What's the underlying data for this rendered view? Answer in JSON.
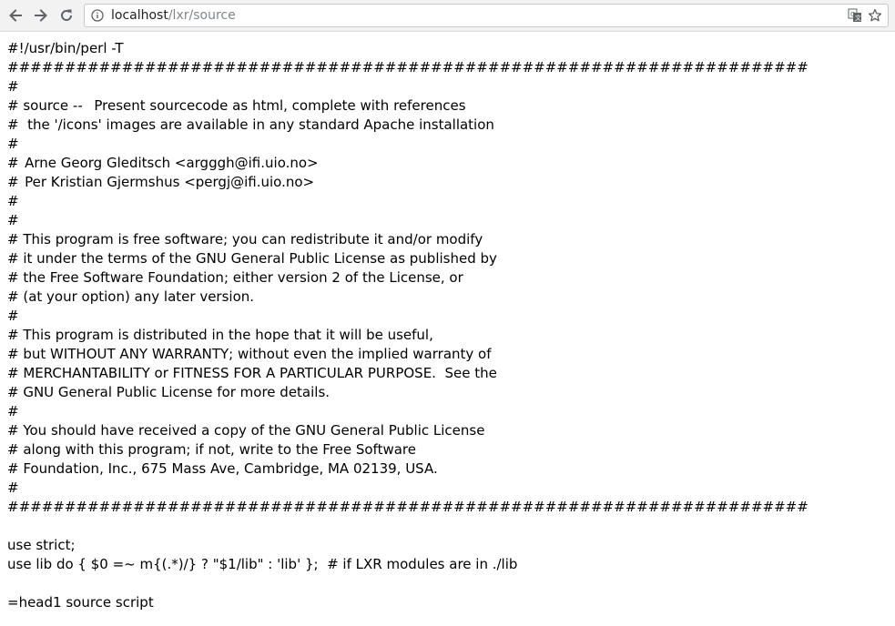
{
  "browser": {
    "url_host": "localhost",
    "url_path": "/lxr/source"
  },
  "document": {
    "lines": [
      "#!/usr/bin/perl -T",
      "######################################################################",
      "#",
      "# source --\tPresent sourcecode as html, complete with references",
      "#  the '/icons' images are available in any standard Apache installation",
      "#",
      "#\tArne Georg Gleditsch <argggh@ifi.uio.no>",
      "#\tPer Kristian Gjermshus <pergj@ifi.uio.no>",
      "#",
      "#",
      "# This program is free software; you can redistribute it and/or modify",
      "# it under the terms of the GNU General Public License as published by",
      "# the Free Software Foundation; either version 2 of the License, or",
      "# (at your option) any later version.",
      "#",
      "# This program is distributed in the hope that it will be useful,",
      "# but WITHOUT ANY WARRANTY; without even the implied warranty of",
      "# MERCHANTABILITY or FITNESS FOR A PARTICULAR PURPOSE.  See the",
      "# GNU General Public License for more details.",
      "#",
      "# You should have received a copy of the GNU General Public License",
      "# along with this program; if not, write to the Free Software",
      "# Foundation, Inc., 675 Mass Ave, Cambridge, MA 02139, USA.",
      "#",
      "######################################################################",
      "",
      "use strict;",
      "use lib do { $0 =~ m{(.*)/} ? \"$1/lib\" : 'lib' };  # if LXR modules are in ./lib",
      "",
      "=head1 source script"
    ]
  }
}
